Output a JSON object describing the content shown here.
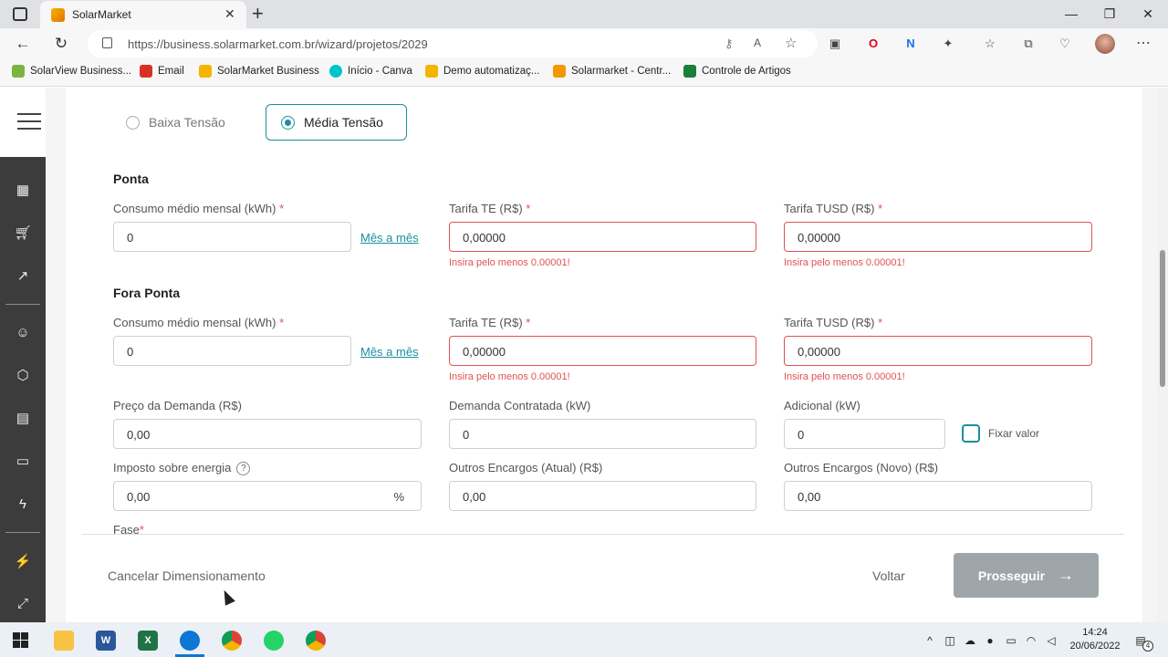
{
  "browser": {
    "tab_title": "SolarMarket",
    "new_tab": "+",
    "url": "https://business.solarmarket.com.br/wizard/projetos/2029",
    "bookmarks": [
      {
        "label": "SolarView Business...",
        "color": "#7cb342"
      },
      {
        "label": "Email",
        "color": "#d93025"
      },
      {
        "label": "SolarMarket Business",
        "color": "#f4b400"
      },
      {
        "label": "Início - Canva",
        "color": "#00c4cc"
      },
      {
        "label": "Demo automatizaç...",
        "color": "#f4b400"
      },
      {
        "label": "Solarmarket - Centr...",
        "color": "#f29900"
      },
      {
        "label": "Controle de Artigos",
        "color": "#188038"
      }
    ]
  },
  "tension": {
    "options": [
      "Baixa Tensão",
      "Média Tensão"
    ],
    "selected": "Média Tensão"
  },
  "ponta": {
    "title": "Ponta",
    "consumo_label": "Consumo médio mensal (kWh)",
    "consumo_value": "0",
    "mes_a_mes": "Mês a mês",
    "te_label": "Tarifa TE (R$)",
    "te_value": "0,00000",
    "te_error": "Insira pelo menos 0.00001!",
    "tusd_label": "Tarifa TUSD (R$)",
    "tusd_value": "0,00000",
    "tusd_error": "Insira pelo menos 0.00001!"
  },
  "fora_ponta": {
    "title": "Fora Ponta",
    "consumo_label": "Consumo médio mensal (kWh)",
    "consumo_value": "0",
    "mes_a_mes": "Mês a mês",
    "te_label": "Tarifa TE (R$)",
    "te_value": "0,00000",
    "te_error": "Insira pelo menos 0.00001!",
    "tusd_label": "Tarifa TUSD (R$)",
    "tusd_value": "0,00000",
    "tusd_error": "Insira pelo menos 0.00001!"
  },
  "demanda": {
    "preco_label": "Preço da Demanda (R$)",
    "preco_value": "0,00",
    "contratada_label": "Demanda Contratada (kW)",
    "contratada_value": "0",
    "adicional_label": "Adicional (kW)",
    "adicional_value": "0",
    "fixar_label": "Fixar valor"
  },
  "encargos": {
    "imposto_label": "Imposto sobre energia",
    "imposto_value": "0,00",
    "imposto_suffix": "%",
    "help": "?",
    "atual_label": "Outros Encargos (Atual) (R$)",
    "atual_value": "0,00",
    "novo_label": "Outros Encargos (Novo) (R$)",
    "novo_value": "0,00"
  },
  "fase_label": "Fase",
  "required_mark": "*",
  "footer": {
    "cancel": "Cancelar Dimensionamento",
    "back": "Voltar",
    "next": "Prosseguir",
    "next_arrow": "→"
  },
  "taskbar": {
    "time": "14:24",
    "date": "20/06/2022",
    "notification_count": "4"
  },
  "colors": {
    "accent": "#1a8fa0",
    "error": "#e05252",
    "sidebar": "#3c3c3c",
    "button_disabled": "#9ea6aa"
  }
}
